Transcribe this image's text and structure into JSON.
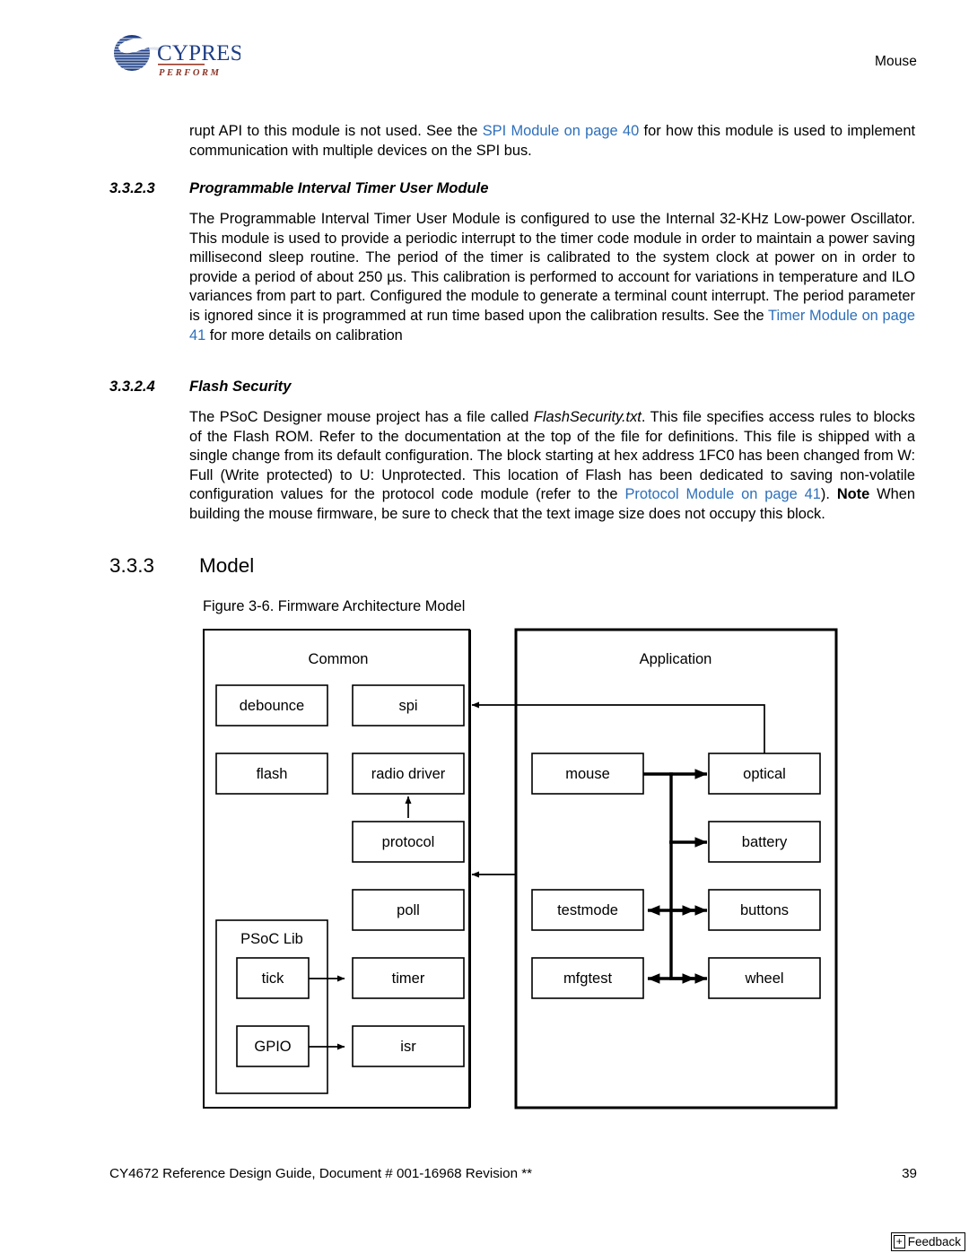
{
  "header": {
    "section_title": "Mouse",
    "logo_wordmark": "CYPRESS",
    "logo_tagline": "PERFORM",
    "logo_icon": "cypress-globe-logo"
  },
  "content": {
    "intro_paragraph": {
      "before_link": "rupt API to this module is not used. See the ",
      "link": "SPI Module on page 40",
      "after_link": " for how this module is used to implement communication with multiple devices on the SPI bus."
    },
    "section_3323": {
      "number": "3.3.2.3",
      "title": "Programmable Interval Timer User Module",
      "paragraph": {
        "before_link": "The Programmable Interval Timer User Module is configured to use the Internal 32-KHz Low-power Oscillator. This module is used to provide a periodic interrupt to the timer code module in order to maintain a power saving millisecond sleep routine. The period of the timer is calibrated to the system clock at power on in order to provide a period of about 250 µs. This calibration is performed to account for variations in temperature and ILO variances from part to part. Configured the module to generate a terminal count interrupt. The period parameter is ignored since it is programmed at run time based upon the calibration results. See the ",
        "link": "Timer Module on page 41",
        "after_link": " for more details on calibration"
      }
    },
    "section_3324": {
      "number": "3.3.2.4",
      "title": "Flash Security",
      "paragraph": {
        "part1": "The PSoC Designer mouse project has a file called ",
        "filename": "FlashSecurity.txt",
        "part2": ". This file specifies access rules to blocks of the Flash ROM. Refer to the documentation at the top of the file for definitions. This file is shipped with a single change from its default configuration. The block starting at hex address 1FC0 has been changed from W: Full (Write protected) to U: Unprotected. This location of Flash has been dedicated to saving non-volatile configuration values for the protocol code module (refer to the ",
        "link": "Protocol Module on page 41",
        "part3": "). ",
        "note_label": "Note",
        "part4": " When building the mouse firmware, be sure to check that the text image size does not occupy this block."
      }
    },
    "section_333": {
      "number": "3.3.3",
      "title": "Model"
    },
    "figure": {
      "caption": "Figure 3-6.  Firmware Architecture Model"
    }
  },
  "diagram": {
    "groups": {
      "common": "Common",
      "application": "Application",
      "psoc_lib": "PSoC Lib"
    },
    "common_boxes": {
      "debounce": "debounce",
      "spi": "spi",
      "flash": "flash",
      "radio_driver": "radio driver",
      "protocol": "protocol",
      "poll": "poll",
      "tick": "tick",
      "timer": "timer",
      "gpio": "GPIO",
      "isr": "isr"
    },
    "application_boxes": {
      "mouse": "mouse",
      "optical": "optical",
      "battery": "battery",
      "testmode": "testmode",
      "buttons": "buttons",
      "mfgtest": "mfgtest",
      "wheel": "wheel"
    },
    "colors": {
      "box_stroke": "#000000",
      "box_fill": "#ffffff",
      "connector": "#000000"
    }
  },
  "footer": {
    "document_line": "CY4672 Reference Design Guide, Document # 001-16968 Revision **",
    "page_number": "39",
    "feedback_plus": "+",
    "feedback_label": "Feedback"
  }
}
